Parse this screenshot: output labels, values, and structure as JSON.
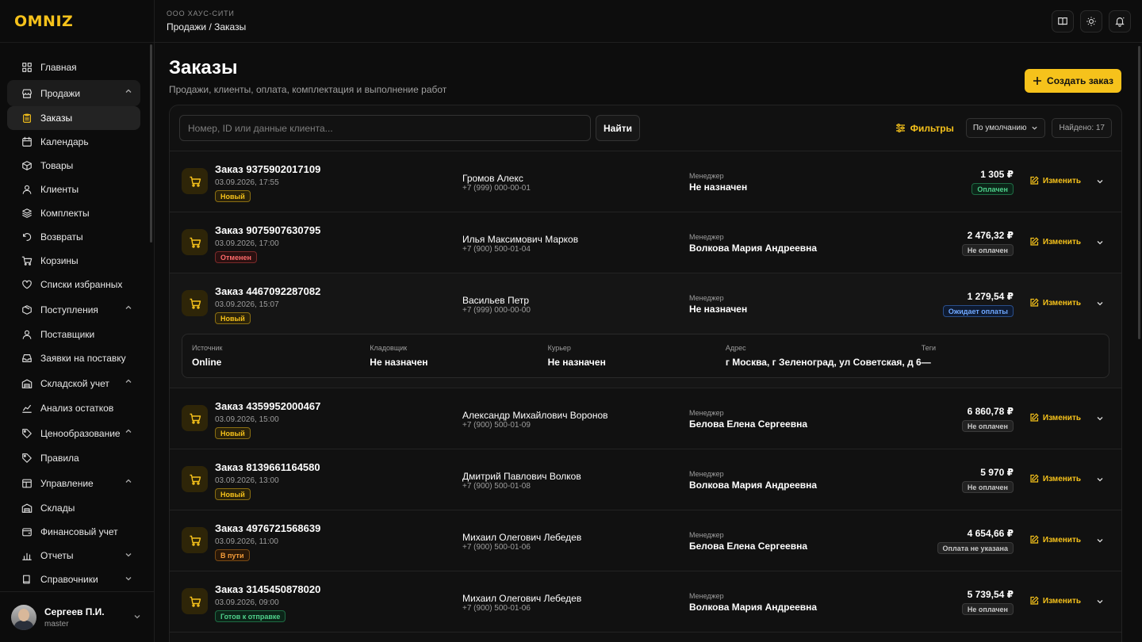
{
  "brand": {
    "logo": "OMNIZ",
    "accent": "#f6c21b"
  },
  "topbar": {
    "org": "ООО ХАУС-СИТИ",
    "breadcrumb": "Продажи / Заказы"
  },
  "sidebar": {
    "items": [
      {
        "label": "Главная",
        "icon": "dashboard-icon",
        "type": "group"
      },
      {
        "label": "Продажи",
        "icon": "store-icon",
        "type": "group",
        "expanded": true
      },
      {
        "label": "Заказы",
        "icon": "clipboard-icon",
        "type": "sub",
        "active": true
      },
      {
        "label": "Календарь",
        "icon": "calendar-icon",
        "type": "sub"
      },
      {
        "label": "Товары",
        "icon": "box-icon",
        "type": "sub"
      },
      {
        "label": "Клиенты",
        "icon": "user-icon",
        "type": "sub"
      },
      {
        "label": "Комплекты",
        "icon": "layers-icon",
        "type": "sub"
      },
      {
        "label": "Возвраты",
        "icon": "undo-icon",
        "type": "sub"
      },
      {
        "label": "Корзины",
        "icon": "cart-icon",
        "type": "sub"
      },
      {
        "label": "Списки избранных",
        "icon": "heart-icon",
        "type": "sub"
      },
      {
        "label": "Поступления",
        "icon": "package-icon",
        "type": "group",
        "expanded": true
      },
      {
        "label": "Поставщики",
        "icon": "user-icon",
        "type": "sub"
      },
      {
        "label": "Заявки на поставку",
        "icon": "inbox-icon",
        "type": "sub"
      },
      {
        "label": "Складской учет",
        "icon": "warehouse-icon",
        "type": "group",
        "expanded": true
      },
      {
        "label": "Анализ остатков",
        "icon": "chart-line-icon",
        "type": "sub"
      },
      {
        "label": "Ценообразование",
        "icon": "tag-icon",
        "type": "group",
        "expanded": true
      },
      {
        "label": "Правила",
        "icon": "tag-icon",
        "type": "sub"
      },
      {
        "label": "Управление",
        "icon": "table-icon",
        "type": "group",
        "expanded": true
      },
      {
        "label": "Склады",
        "icon": "warehouse-icon",
        "type": "sub"
      },
      {
        "label": "Финансовый учет",
        "icon": "wallet-icon",
        "type": "sub"
      },
      {
        "label": "Отчеты",
        "icon": "bar-chart-icon",
        "type": "sub",
        "expandable": true
      },
      {
        "label": "Справочники",
        "icon": "book-icon",
        "type": "sub",
        "expandable": true
      }
    ]
  },
  "user": {
    "name": "Сергеев П.И.",
    "role": "master"
  },
  "page": {
    "title": "Заказы",
    "subtitle": "Продажи, клиенты, оплата, комплектация и выполнение работ",
    "create_label": "Создать заказ"
  },
  "toolbar": {
    "search_placeholder": "Номер, ID или данные клиента...",
    "find_label": "Найти",
    "filters_label": "Фильтры",
    "sort_label": "По умолчанию",
    "found_label": "Найдено: 17"
  },
  "labels": {
    "manager": "Менеджер",
    "edit": "Изменить"
  },
  "orders": [
    {
      "number": "Заказ 9375902017109",
      "date": "03.09.2026, 17:55",
      "status": "Новый",
      "status_kind": "new",
      "client": "Громов Алекс",
      "phone": "+7 (999) 000-00-01",
      "manager": "Не назначен",
      "sum": "1 305 ₽",
      "payment": "Оплачен",
      "payment_kind": "paid"
    },
    {
      "number": "Заказ 9075907630795",
      "date": "03.09.2026, 17:00",
      "status": "Отменен",
      "status_kind": "cancel",
      "client": "Илья Максимович Марков",
      "phone": "+7 (900) 500-01-04",
      "manager": "Волкова Мария Андреевна",
      "sum": "2 476,32 ₽",
      "payment": "Не оплачен",
      "payment_kind": "unpaid"
    },
    {
      "number": "Заказ 4467092287082",
      "date": "03.09.2026, 15:07",
      "status": "Новый",
      "status_kind": "new",
      "client": "Васильев Петр",
      "phone": "+7 (999) 000-00-00",
      "manager": "Не назначен",
      "sum": "1 279,54 ₽",
      "payment": "Ожидает оплаты",
      "payment_kind": "wait",
      "expanded": true,
      "details": [
        {
          "label": "Источник",
          "value": "Online"
        },
        {
          "label": "Кладовщик",
          "value": "Не назначен"
        },
        {
          "label": "Курьер",
          "value": "Не назначен"
        },
        {
          "label": "Адрес",
          "value": "г Москва, г Зеленоград, ул Советская, д 6"
        },
        {
          "label": "Теги",
          "value": "—"
        }
      ]
    },
    {
      "number": "Заказ 4359952000467",
      "date": "03.09.2026, 15:00",
      "status": "Новый",
      "status_kind": "new",
      "client": "Александр Михайлович Воронов",
      "phone": "+7 (900) 500-01-09",
      "manager": "Белова Елена Сергеевна",
      "sum": "6 860,78 ₽",
      "payment": "Не оплачен",
      "payment_kind": "unpaid"
    },
    {
      "number": "Заказ 8139661164580",
      "date": "03.09.2026, 13:00",
      "status": "Новый",
      "status_kind": "new",
      "client": "Дмитрий Павлович Волков",
      "phone": "+7 (900) 500-01-08",
      "manager": "Волкова Мария Андреевна",
      "sum": "5 970 ₽",
      "payment": "Не оплачен",
      "payment_kind": "unpaid"
    },
    {
      "number": "Заказ 4976721568639",
      "date": "03.09.2026, 11:00",
      "status": "В пути",
      "status_kind": "transit",
      "client": "Михаил Олегович Лебедев",
      "phone": "+7 (900) 500-01-06",
      "manager": "Белова Елена Сергеевна",
      "sum": "4 654,66 ₽",
      "payment": "Оплата не указана",
      "payment_kind": "none"
    },
    {
      "number": "Заказ 3145450878020",
      "date": "03.09.2026, 09:00",
      "status": "Готов к отправке",
      "status_kind": "ready",
      "client": "Михаил Олегович Лебедев",
      "phone": "+7 (900) 500-01-06",
      "manager": "Волкова Мария Андреевна",
      "sum": "5 739,54 ₽",
      "payment": "Не оплачен",
      "payment_kind": "unpaid"
    }
  ]
}
